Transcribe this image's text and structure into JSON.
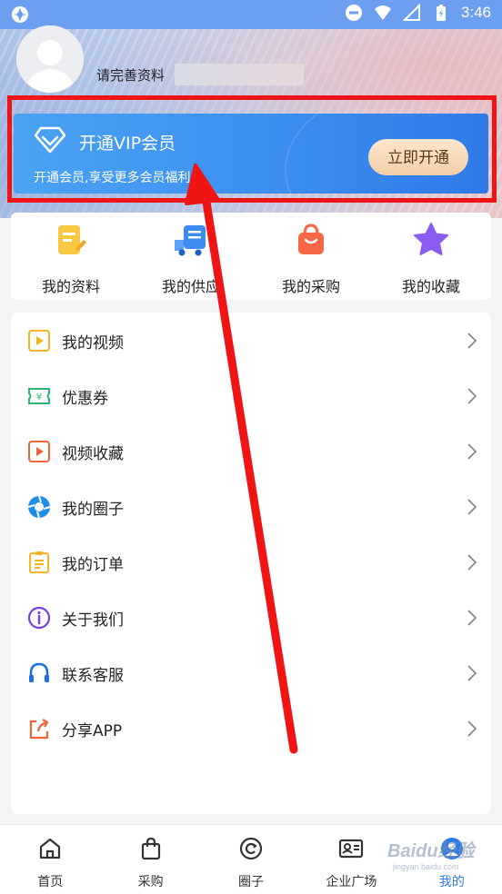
{
  "status_bar": {
    "time": "3:46"
  },
  "profile": {
    "prompt": "请完善资料"
  },
  "vip": {
    "title": "开通VIP会员",
    "subtitle": "开通会员,享受更多会员福利",
    "button": "立即开通"
  },
  "quick_actions": [
    {
      "label": "我的资料",
      "icon": "profile-doc-icon"
    },
    {
      "label": "我的供应",
      "icon": "supply-truck-icon"
    },
    {
      "label": "我的采购",
      "icon": "shopping-bag-icon"
    },
    {
      "label": "我的收藏",
      "icon": "star-icon"
    }
  ],
  "menu": [
    {
      "label": "我的视频",
      "icon": "video-icon"
    },
    {
      "label": "优惠券",
      "icon": "coupon-icon"
    },
    {
      "label": "视频收藏",
      "icon": "video-favorite-icon"
    },
    {
      "label": "我的圈子",
      "icon": "aperture-icon"
    },
    {
      "label": "我的订单",
      "icon": "clipboard-icon"
    },
    {
      "label": "关于我们",
      "icon": "info-icon"
    },
    {
      "label": "联系客服",
      "icon": "headset-icon"
    },
    {
      "label": "分享APP",
      "icon": "share-icon"
    }
  ],
  "tabs": [
    {
      "label": "首页",
      "icon": "home-icon"
    },
    {
      "label": "采购",
      "icon": "bag-icon"
    },
    {
      "label": "圈子",
      "icon": "circle-refresh-icon"
    },
    {
      "label": "企业广场",
      "icon": "id-card-icon"
    },
    {
      "label": "我的",
      "icon": "user-icon",
      "active": true
    }
  ],
  "watermark": {
    "brand": "Baidu经验",
    "url": "jingyan.baidu.com"
  },
  "colors": {
    "accent": "#2f7ae8",
    "highlight": "#f01414",
    "vip_button": "#f5cfa8"
  }
}
